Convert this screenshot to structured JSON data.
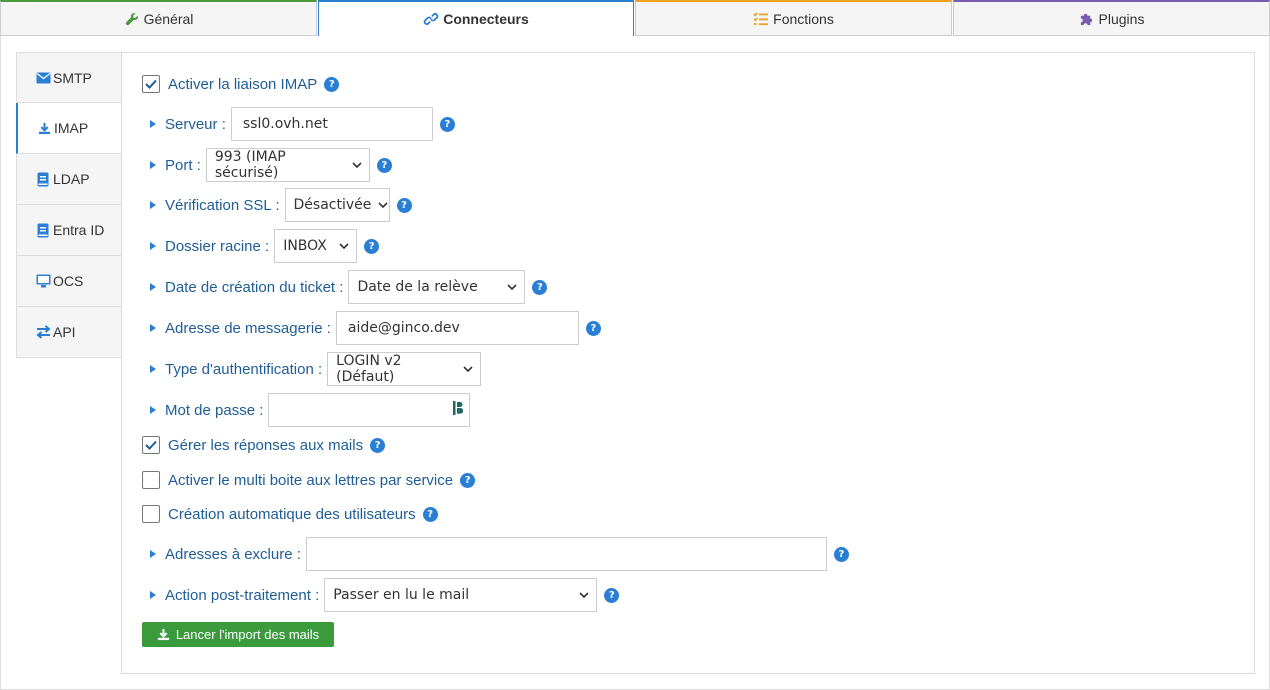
{
  "top_tabs": [
    {
      "label": "Général",
      "icon": "wrench-icon",
      "color": "#4a9a3b"
    },
    {
      "label": "Connecteurs",
      "icon": "link-icon",
      "color": "#2a7fd4"
    },
    {
      "label": "Fonctions",
      "icon": "list-icon",
      "color": "#f0a020"
    },
    {
      "label": "Plugins",
      "icon": "puzzle-icon",
      "color": "#7b5bb0"
    }
  ],
  "side_tabs": [
    {
      "label": "SMTP",
      "icon": "envelope-icon"
    },
    {
      "label": "IMAP",
      "icon": "download-icon"
    },
    {
      "label": "LDAP",
      "icon": "address-book-icon"
    },
    {
      "label": "Entra ID",
      "icon": "address-book-icon"
    },
    {
      "label": "OCS",
      "icon": "monitor-icon"
    },
    {
      "label": "API",
      "icon": "exchange-icon"
    }
  ],
  "form": {
    "enable_imap": {
      "label": "Activer la liaison IMAP",
      "checked": true
    },
    "server": {
      "label": "Serveur :",
      "value": "ssl0.ovh.net"
    },
    "port": {
      "label": "Port :",
      "value": "993 (IMAP sécurisé)"
    },
    "ssl_check": {
      "label": "Vérification SSL :",
      "value": "Désactivée"
    },
    "root_folder": {
      "label": "Dossier racine :",
      "value": "INBOX"
    },
    "ticket_date": {
      "label": "Date de création du ticket :",
      "value": "Date de la relève"
    },
    "email": {
      "label": "Adresse de messagerie :",
      "value": "aide@ginco.dev"
    },
    "auth_type": {
      "label": "Type d'authentification :",
      "value": "LOGIN v2 (Défaut)"
    },
    "password": {
      "label": "Mot de passe :",
      "value": ""
    },
    "manage_replies": {
      "label": "Gérer les réponses aux mails",
      "checked": true
    },
    "multi_mailbox": {
      "label": "Activer le multi boite aux lettres par service",
      "checked": false
    },
    "auto_create_users": {
      "label": "Création automatique des utilisateurs",
      "checked": false
    },
    "exclude_addresses": {
      "label": "Adresses à exclure :",
      "value": ""
    },
    "post_action": {
      "label": "Action post-traitement :",
      "value": "Passer en lu le mail"
    },
    "import_button": "Lancer l'import des mails"
  },
  "help_glyph": "?",
  "colors": {
    "accent": "#2a7fd4",
    "label": "#1f5d97",
    "button_green": "#3a9a3c"
  }
}
